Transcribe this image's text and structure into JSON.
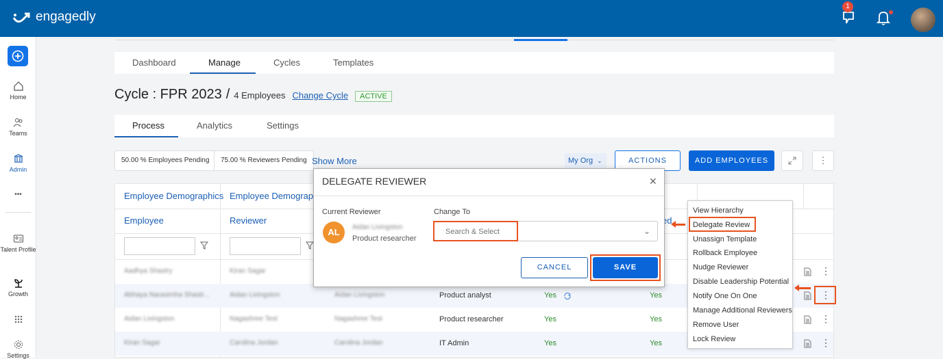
{
  "brand": {
    "name": "engagedly"
  },
  "header": {
    "notification_count": "1"
  },
  "sidebar": {
    "items": [
      {
        "label": "Home",
        "icon": "home-icon"
      },
      {
        "label": "Teams",
        "icon": "teams-icon"
      },
      {
        "label": "Admin",
        "icon": "admin-icon"
      },
      {
        "label": "Talent Profile",
        "icon": "talent-profile-icon"
      },
      {
        "label": "Growth",
        "icon": "growth-icon"
      },
      {
        "label": "Settings",
        "icon": "gear-icon"
      }
    ],
    "more": "•••"
  },
  "main_tabs": [
    "Dashboard",
    "Manage",
    "Cycles",
    "Templates"
  ],
  "cycle": {
    "title": "Cycle : FPR 2023",
    "separator": "/",
    "employee_count": "4 Employees",
    "change_link": "Change Cycle",
    "status": "ACTIVE"
  },
  "sub_tabs": [
    "Process",
    "Analytics",
    "Settings"
  ],
  "toolbar": {
    "employees_pending": "50.00 % Employees Pending",
    "reviewers_pending": "75.00 % Reviewers Pending",
    "show_more": "Show More",
    "org_filter": "My Org",
    "actions": "ACTIONS",
    "add_employees": "ADD EMPLOYEES"
  },
  "table": {
    "group_headers": [
      "Employee Demographics",
      "Employee Demographics"
    ],
    "columns": [
      "Employee",
      "Reviewer"
    ],
    "partial_header": "ed",
    "rows": [
      {
        "employee": "Aadhya Shastry",
        "reviewer": "Kiran Sagar",
        "col3": "",
        "role": "",
        "status1": "",
        "status2": ""
      },
      {
        "employee": "Abhaya Narasimha Shastr...",
        "reviewer": "Aidan Livingston",
        "col3": "Aidan Livingston",
        "role": "Product analyst",
        "status1": "Yes",
        "status2": "Yes"
      },
      {
        "employee": "Aidan Livingston",
        "reviewer": "Nagashree Test",
        "col3": "Nagashree Test",
        "role": "Product researcher",
        "status1": "Yes",
        "status2": "Yes"
      },
      {
        "employee": "Kiran Sagar",
        "reviewer": "Carolina Jordan",
        "col3": "Carolina Jordan",
        "role": "IT Admin",
        "status1": "Yes",
        "status2": "Yes"
      }
    ]
  },
  "context_menu": {
    "items": [
      "View Hierarchy",
      "Delegate Review",
      "Unassign Template",
      "Rollback Employee",
      "Nudge Reviewer",
      "Disable Leadership Potential",
      "Notify One On One",
      "Manage Additional Reviewers",
      "Remove User",
      "Lock Review"
    ]
  },
  "modal": {
    "title": "DELEGATE REVIEWER",
    "current_label": "Current Reviewer",
    "change_label": "Change To",
    "avatar_initials": "AL",
    "reviewer_name": "Aidan Livingston",
    "reviewer_role": "Product researcher",
    "select_placeholder": "Search & Select",
    "cancel": "CANCEL",
    "save": "SAVE"
  },
  "colors": {
    "brand": "#0060a8",
    "primary": "#0a66d8",
    "highlight": "#e8521e",
    "success": "#2e8b2e"
  }
}
